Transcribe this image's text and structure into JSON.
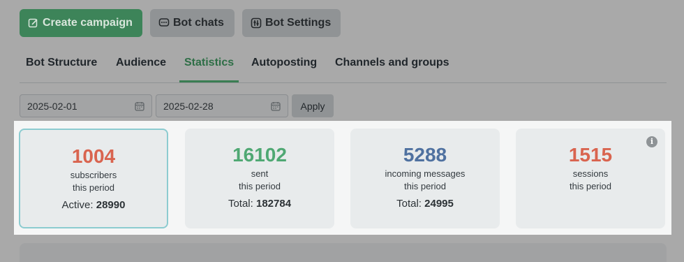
{
  "toolbar": {
    "create_campaign": "Create campaign",
    "bot_chats": "Bot chats",
    "bot_settings": "Bot Settings"
  },
  "tabs": [
    {
      "label": "Bot Structure",
      "active": false
    },
    {
      "label": "Audience",
      "active": false
    },
    {
      "label": "Statistics",
      "active": true
    },
    {
      "label": "Autoposting",
      "active": false
    },
    {
      "label": "Channels and groups",
      "active": false
    }
  ],
  "filters": {
    "date_from": "2025-02-01",
    "date_to": "2025-02-28",
    "apply_label": "Apply"
  },
  "stats": [
    {
      "value": "1004",
      "label1": "subscribers",
      "label2": "this period",
      "total_label": "Active:",
      "total_value": "28990",
      "color": "#d9644f"
    },
    {
      "value": "16102",
      "label1": "sent",
      "label2": "this period",
      "total_label": "Total:",
      "total_value": "182784",
      "color": "#4fa873"
    },
    {
      "value": "5288",
      "label1": "incoming messages",
      "label2": "this period",
      "total_label": "Total:",
      "total_value": "24995",
      "color": "#4f71a0"
    },
    {
      "value": "1515",
      "label1": "sessions",
      "label2": "this period",
      "color": "#d9644f"
    }
  ],
  "icons": {
    "info": "i"
  }
}
